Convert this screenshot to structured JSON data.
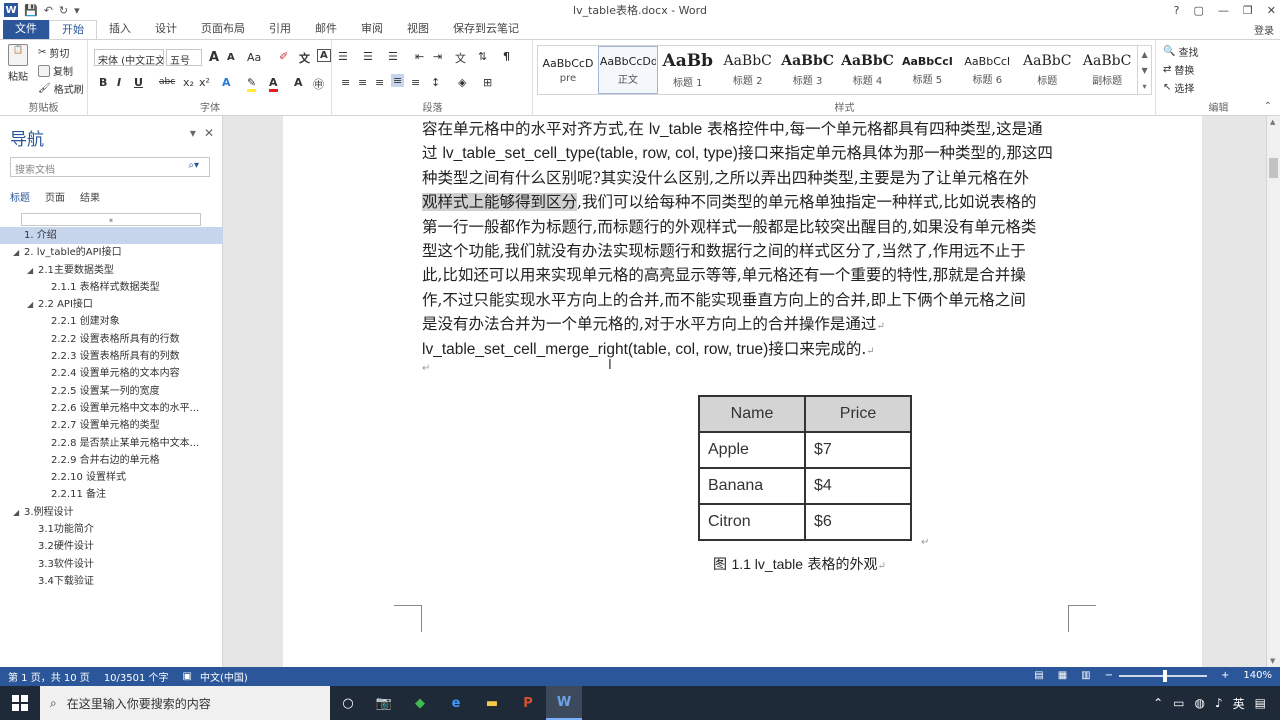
{
  "window": {
    "title": "lv_table表格.docx - Word",
    "help": "?",
    "login": "登录"
  },
  "ribbon_tabs": [
    "文件",
    "开始",
    "插入",
    "设计",
    "页面布局",
    "引用",
    "邮件",
    "审阅",
    "视图",
    "保存到云笔记"
  ],
  "clipboard": {
    "paste": "粘贴",
    "cut": "剪切",
    "copy": "复制",
    "format_painter": "格式刷",
    "label": "剪贴板"
  },
  "font": {
    "name": "宋体 (中文正文",
    "size": "五号",
    "grow": "A",
    "shrink": "A",
    "case": "Aa",
    "label": "字体",
    "bold": "B",
    "italic": "I",
    "underline": "U",
    "strike": "abc",
    "sub": "x₂",
    "sup": "x²"
  },
  "paragraph": {
    "label": "段落"
  },
  "styles": {
    "label": "样式",
    "items": [
      {
        "sample": "AaBbCcD",
        "name": "pre"
      },
      {
        "sample": "AaBbCcDd",
        "name": "正文"
      },
      {
        "sample": "AaBb",
        "name": "标题 1"
      },
      {
        "sample": "AaBbC",
        "name": "标题 2"
      },
      {
        "sample": "AaBbC",
        "name": "标题 3"
      },
      {
        "sample": "AaBbC",
        "name": "标题 4"
      },
      {
        "sample": "AaBbCcI",
        "name": "标题 5"
      },
      {
        "sample": "AaBbCcI",
        "name": "标题 6"
      },
      {
        "sample": "AaBbC",
        "name": "标题"
      },
      {
        "sample": "AaBbC",
        "name": "副标题"
      }
    ]
  },
  "editing": {
    "find": "查找",
    "replace": "替换",
    "select": "选择",
    "label": "编辑"
  },
  "nav": {
    "title": "导航",
    "search_placeholder": "搜索文档",
    "tabs": [
      "标题",
      "页面",
      "结果"
    ],
    "items": [
      {
        "label": "1. 介绍",
        "level": 1,
        "selected": true
      },
      {
        "label": "2. lv_table的API接口",
        "level": 1,
        "expand": true
      },
      {
        "label": "2.1主要数据类型",
        "level": 2,
        "expand": true
      },
      {
        "label": "2.1.1 表格样式数据类型",
        "level": 3
      },
      {
        "label": "2.2 API接口",
        "level": 2,
        "expand": true
      },
      {
        "label": "2.2.1 创建对象",
        "level": 3
      },
      {
        "label": "2.2.2 设置表格所具有的行数",
        "level": 3
      },
      {
        "label": "2.2.3 设置表格所具有的列数",
        "level": 3
      },
      {
        "label": "2.2.4 设置单元格的文本内容",
        "level": 3
      },
      {
        "label": "2.2.5 设置某一列的宽度",
        "level": 3
      },
      {
        "label": "2.2.6 设置单元格中文本的水平...",
        "level": 3
      },
      {
        "label": "2.2.7 设置单元格的类型",
        "level": 3
      },
      {
        "label": "2.2.8 是否禁止某单元格中文本...",
        "level": 3
      },
      {
        "label": "2.2.9 合并右边的单元格",
        "level": 3
      },
      {
        "label": "2.2.10 设置样式",
        "level": 3
      },
      {
        "label": "2.2.11 备注",
        "level": 3
      },
      {
        "label": "3.例程设计",
        "level": 1,
        "expand": true
      },
      {
        "label": "3.1功能简介",
        "level": 2
      },
      {
        "label": "3.2硬件设计",
        "level": 2
      },
      {
        "label": "3.3软件设计",
        "level": 2
      },
      {
        "label": "3.4下载验证",
        "level": 2
      }
    ]
  },
  "doc": {
    "lines": [
      [
        "容在单元格中的水平对齐方式,在 ",
        "lv_table",
        " 表格控件中,每一个单元格都具有四种类型,这是通"
      ],
      [
        "过 ",
        "lv_table_set_cell_type(table, row, col, type)",
        "接口来指定单元格具体为那一种类型的,那这四"
      ],
      [
        "种类型之间有什么区别呢?其实没什么区别,之所以弄出四种类型,主要是为了让单元格在外"
      ],
      [
        "观样式上能够得到区分",
        ",我们可以给每种不同类型的单元格单独指定一种样式,比如说表格的"
      ],
      [
        "第一行一般都作为标题行,而标题行的外观样式一般都是比较突出醒目的,如果没有单元格类"
      ],
      [
        "型这个功能,我们就没有办法实现标题行和数据行之间的样式区分了,当然了,作用远不止于"
      ],
      [
        "此,比如还可以用来实现单元格的高亮显示等等,单元格还有一个重要的特性,那就是合并操"
      ],
      [
        "作,不过只能实现水平方向上的合并,而不能实现垂直方向上的合并,即上下俩个单元格之间"
      ],
      [
        "是没有办法合并为一个单元格的,对于水平方向上的合并操作是通过"
      ],
      [
        "lv_table_set_cell_merge_right(table, col, row, true)",
        "接口来完成的."
      ]
    ],
    "table": {
      "headers": [
        "Name",
        "Price"
      ],
      "rows": [
        [
          "Apple",
          "$7"
        ],
        [
          "Banana",
          "$4"
        ],
        [
          "Citron",
          "$6"
        ]
      ]
    },
    "caption_prefix": "图 ",
    "caption_num": "1.1 lv_table",
    "caption_suffix": " 表格的外观"
  },
  "status": {
    "page": "第 1 页，共 10 页",
    "words": "10/3501 个字",
    "lang": "中文(中国)",
    "zoom": "140%"
  },
  "taskbar": {
    "search_placeholder": "在这里输入你要搜索的内容",
    "ime": "英"
  },
  "colors": {
    "accent": "#2b579a",
    "selection": "#c6d5ec",
    "highlight": "#d0d0d0",
    "table_header": "#d4d4d4"
  }
}
